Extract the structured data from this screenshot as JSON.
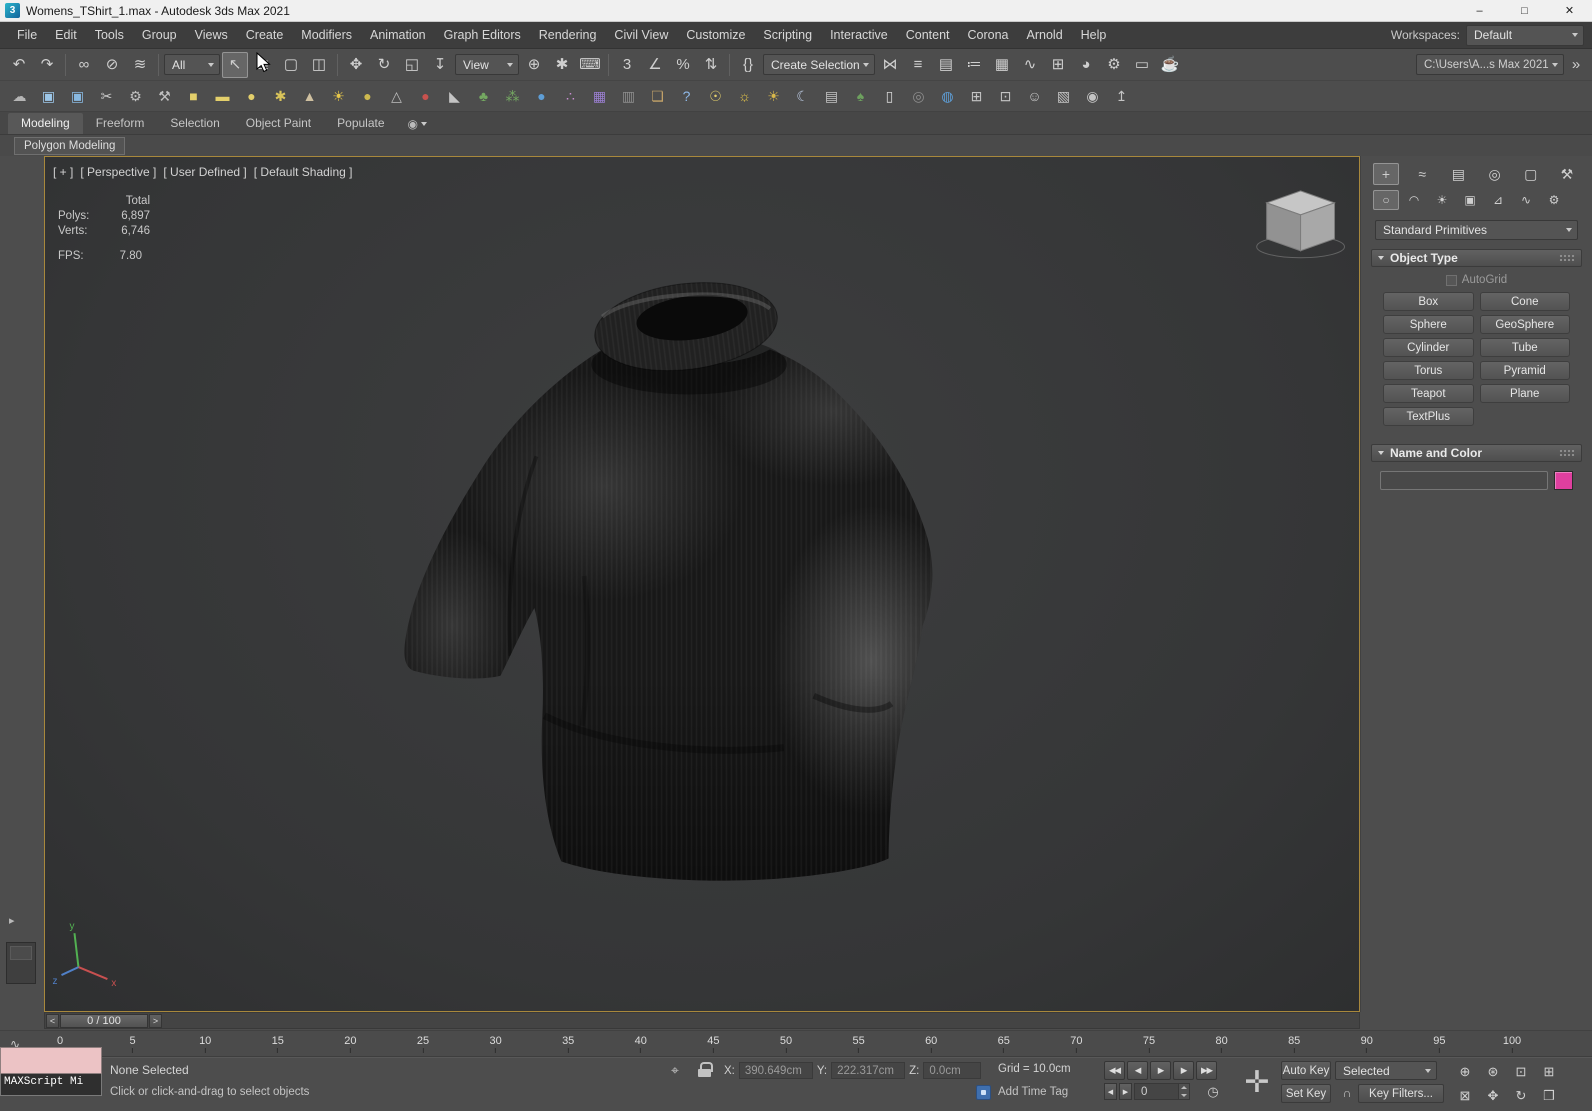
{
  "colors": {
    "chrome": "#4d4d4d",
    "titlebar": "#f0f0f0",
    "viewport-border": "#a8883c",
    "swatch": "#df3f9f",
    "maxscript-pink": "#ecc3c5"
  },
  "titlebar": {
    "icon_text": "3",
    "title": "Womens_TShirt_1.max - Autodesk 3ds Max 2021",
    "minimize": "–",
    "maximize": "□",
    "close": "✕"
  },
  "menubar": {
    "items": [
      {
        "label": "File",
        "name": "menu-file"
      },
      {
        "label": "Edit",
        "name": "menu-edit"
      },
      {
        "label": "Tools",
        "name": "menu-tools"
      },
      {
        "label": "Group",
        "name": "menu-group"
      },
      {
        "label": "Views",
        "name": "menu-views"
      },
      {
        "label": "Create",
        "name": "menu-create"
      },
      {
        "label": "Modifiers",
        "name": "menu-modifiers"
      },
      {
        "label": "Animation",
        "name": "menu-animation"
      },
      {
        "label": "Graph Editors",
        "name": "menu-graph-editors"
      },
      {
        "label": "Rendering",
        "name": "menu-rendering"
      },
      {
        "label": "Civil View",
        "name": "menu-civil-view"
      },
      {
        "label": "Customize",
        "name": "menu-customize"
      },
      {
        "label": "Scripting",
        "name": "menu-scripting"
      },
      {
        "label": "Interactive",
        "name": "menu-interactive"
      },
      {
        "label": "Content",
        "name": "menu-content"
      },
      {
        "label": "Corona",
        "name": "menu-corona"
      },
      {
        "label": "Arnold",
        "name": "menu-arnold"
      },
      {
        "label": "Help",
        "name": "menu-help"
      }
    ],
    "workspaces_label": "Workspaces:",
    "workspaces_value": "Default"
  },
  "toolbar1": {
    "history": [
      {
        "name": "undo-button",
        "glyph": "↶"
      },
      {
        "name": "redo-button",
        "glyph": "↷"
      }
    ],
    "link": [
      {
        "name": "select-and-link-button",
        "glyph": "∞"
      },
      {
        "name": "unlink-selection-button",
        "glyph": "⊘"
      },
      {
        "name": "bind-to-space-warp-button",
        "glyph": "≋"
      }
    ],
    "filter_value": "All",
    "select": [
      {
        "name": "select-object-button",
        "glyph": "↖",
        "active": true
      },
      {
        "name": "select-by-name-button",
        "glyph": "≣"
      },
      {
        "name": "rectangular-selection-button",
        "glyph": "▢"
      },
      {
        "name": "window-crossing-button",
        "glyph": "◫"
      }
    ],
    "transform": [
      {
        "name": "select-and-move-button",
        "glyph": "✥"
      },
      {
        "name": "select-and-rotate-button",
        "glyph": "↻"
      },
      {
        "name": "select-and-scale-button",
        "glyph": "◱"
      },
      {
        "name": "select-and-place-button",
        "glyph": "↧"
      }
    ],
    "coord_value": "View",
    "pivot": [
      {
        "name": "use-pivot-point-center-button",
        "glyph": "⊕"
      },
      {
        "name": "select-and-manipulate-button",
        "glyph": "✱"
      },
      {
        "name": "keyboard-override-button",
        "glyph": "⌨"
      }
    ],
    "snaps": [
      {
        "name": "snaps-toggle-button",
        "glyph": "3"
      },
      {
        "name": "angle-snap-button",
        "glyph": "∠"
      },
      {
        "name": "percent-snap-button",
        "glyph": "%"
      },
      {
        "name": "spinner-snap-button",
        "glyph": "⇅"
      }
    ],
    "named_sets_glyph": "{}",
    "sets_value": "Create Selection Se",
    "tools": [
      {
        "name": "mirror-button",
        "glyph": "⋈"
      },
      {
        "name": "align-button",
        "glyph": "≡"
      },
      {
        "name": "toggle-scene-explorer-button",
        "glyph": "▤"
      },
      {
        "name": "toggle-layer-explorer-button",
        "glyph": "≔"
      },
      {
        "name": "toggle-ribbon-button",
        "glyph": "▦"
      },
      {
        "name": "curve-editor-button",
        "glyph": "∿"
      },
      {
        "name": "schematic-view-button",
        "glyph": "⊞"
      },
      {
        "name": "material-editor-button",
        "glyph": "◕"
      },
      {
        "name": "render-setup-button",
        "glyph": "⚙"
      },
      {
        "name": "rendered-frame-button",
        "glyph": "▭"
      },
      {
        "name": "render-production-button",
        "glyph": "☕"
      }
    ],
    "project_path": "C:\\Users\\A...s Max 2021",
    "overflow_glyph": "»"
  },
  "toolbar2": {
    "items": [
      {
        "name": "paint-deform-icon",
        "glyph": "☁",
        "color": "#b5b5b5"
      },
      {
        "name": "snap-box-icon",
        "glyph": "▣",
        "color": "#9cc6e8"
      },
      {
        "name": "snap-box-alt-icon",
        "glyph": "▣",
        "color": "#88b8e0"
      },
      {
        "name": "cut-tool-icon",
        "glyph": "✂",
        "color": "#c8c8c8"
      },
      {
        "name": "gears-tool-icon",
        "glyph": "⚙",
        "color": "#c0c0c0"
      },
      {
        "name": "pick-tool-icon",
        "glyph": "⚒",
        "color": "#c0c0c0"
      },
      {
        "name": "box-primitive-icon",
        "glyph": "■",
        "color": "#e3cf6b"
      },
      {
        "name": "capsule-primitive-icon",
        "glyph": "▬",
        "color": "#e3cf6b"
      },
      {
        "name": "circle-primitive-icon",
        "glyph": "●",
        "color": "#e3cf6b"
      },
      {
        "name": "gear-primitive-icon",
        "glyph": "✱",
        "color": "#d8c35a"
      },
      {
        "name": "cone-primitive-icon",
        "glyph": "▲",
        "color": "#cfc0a0"
      },
      {
        "name": "sun-primitive-icon",
        "glyph": "☀",
        "color": "#e8c84a"
      },
      {
        "name": "sphere-primitive-icon",
        "glyph": "●",
        "color": "#cdb94f"
      },
      {
        "name": "lattice-icon",
        "glyph": "△",
        "color": "#bdbdbd"
      },
      {
        "name": "red-sphere-icon",
        "glyph": "●",
        "color": "#c8524e"
      },
      {
        "name": "pyramid-icon",
        "glyph": "◣",
        "color": "#c4c4c4"
      },
      {
        "name": "foliage-icon",
        "glyph": "♣",
        "color": "#74a861"
      },
      {
        "name": "grass-icon",
        "glyph": "⁂",
        "color": "#74a861"
      },
      {
        "name": "blue-sphere-icon",
        "glyph": "●",
        "color": "#5e9ed6"
      },
      {
        "name": "molecule-icon",
        "glyph": "∴",
        "color": "#c98fd2"
      },
      {
        "name": "image-map-icon",
        "glyph": "▦",
        "color": "#9a7fd0"
      },
      {
        "name": "portrait-icon",
        "glyph": "▥",
        "color": "#8d8d8d"
      },
      {
        "name": "crate-icon",
        "glyph": "❏",
        "color": "#c4a369"
      },
      {
        "name": "help-icon",
        "glyph": "?",
        "color": "#8fb9e8"
      },
      {
        "name": "lightbulb-icon",
        "glyph": "☉",
        "color": "#e3cf6b"
      },
      {
        "name": "sunlight-icon",
        "glyph": "☼",
        "color": "#e8c84a"
      },
      {
        "name": "daylight-icon",
        "glyph": "☀",
        "color": "#d8b84a"
      },
      {
        "name": "moon-icon",
        "glyph": "☾",
        "color": "#bac9e2"
      },
      {
        "name": "book-icon",
        "glyph": "▤",
        "color": "#c4c4c4"
      },
      {
        "name": "tree-icon",
        "glyph": "♠",
        "color": "#6da05e"
      },
      {
        "name": "page-icon",
        "glyph": "▯",
        "color": "#d6d6d6"
      },
      {
        "name": "torus-icon",
        "glyph": "◎",
        "color": "#8d8d8d"
      },
      {
        "name": "globe-icon",
        "glyph": "◍",
        "color": "#5e9ed6"
      },
      {
        "name": "grid-plus-icon",
        "glyph": "⊞",
        "color": "#c4c4c4"
      },
      {
        "name": "monitor-icon",
        "glyph": "⊡",
        "color": "#c4c4c4"
      },
      {
        "name": "people-icon",
        "glyph": "☺",
        "color": "#c4c4c4"
      },
      {
        "name": "film-icon",
        "glyph": "▧",
        "color": "#c4c4c4"
      },
      {
        "name": "eye-icon",
        "glyph": "◉",
        "color": "#c4c4c4"
      },
      {
        "name": "lamp-icon",
        "glyph": "↥",
        "color": "#c4c4c4"
      }
    ]
  },
  "ribbon": {
    "tabs": [
      {
        "label": "Modeling",
        "name": "ribbon-tab-modeling",
        "active": true
      },
      {
        "label": "Freeform",
        "name": "ribbon-tab-freeform"
      },
      {
        "label": "Selection",
        "name": "ribbon-tab-selection"
      },
      {
        "label": "Object Paint",
        "name": "ribbon-tab-object-paint"
      },
      {
        "label": "Populate",
        "name": "ribbon-tab-populate"
      }
    ],
    "overflow_glyph": "◉",
    "panel_tab": "Polygon Modeling"
  },
  "viewport": {
    "label_segments": [
      {
        "text": "[ + ]",
        "name": "viewport-general-menu"
      },
      {
        "text": "[ Perspective ]",
        "name": "viewport-pov-menu"
      },
      {
        "text": "[ User Defined ]",
        "name": "viewport-lighting-menu"
      },
      {
        "text": "[ Default Shading ]",
        "name": "viewport-shading-menu"
      }
    ],
    "stats": {
      "total_label": "Total",
      "polys_label": "Polys:",
      "polys_value": "6,897",
      "verts_label": "Verts:",
      "verts_value": "6,746",
      "fps_label": "FPS:",
      "fps_value": "7.80"
    }
  },
  "command_panel": {
    "tabs": [
      {
        "name": "tab-create",
        "glyph": "+",
        "active": true
      },
      {
        "name": "tab-modify",
        "glyph": "≈"
      },
      {
        "name": "tab-hierarchy",
        "glyph": "▤"
      },
      {
        "name": "tab-motion",
        "glyph": "◎"
      },
      {
        "name": "tab-display",
        "glyph": "▢"
      },
      {
        "name": "tab-utilities",
        "glyph": "⚒"
      }
    ],
    "subtabs": [
      {
        "name": "subtab-geometry",
        "glyph": "○",
        "active": true
      },
      {
        "name": "subtab-shapes",
        "glyph": "◠"
      },
      {
        "name": "subtab-lights",
        "glyph": "☀"
      },
      {
        "name": "subtab-cameras",
        "glyph": "▣"
      },
      {
        "name": "subtab-helpers",
        "glyph": "⊿"
      },
      {
        "name": "subtab-space-warps",
        "glyph": "∿"
      },
      {
        "name": "subtab-systems",
        "glyph": "⚙"
      }
    ],
    "category_dropdown": "Standard Primitives",
    "object_type": {
      "title": "Object Type",
      "autogrid_label": "AutoGrid",
      "buttons": [
        {
          "label": "Box",
          "name": "object-type-box-button"
        },
        {
          "label": "Cone",
          "name": "object-type-cone-button"
        },
        {
          "label": "Sphere",
          "name": "object-type-sphere-button"
        },
        {
          "label": "GeoSphere",
          "name": "object-type-geosphere-button"
        },
        {
          "label": "Cylinder",
          "name": "object-type-cylinder-button"
        },
        {
          "label": "Tube",
          "name": "object-type-tube-button"
        },
        {
          "label": "Torus",
          "name": "object-type-torus-button"
        },
        {
          "label": "Pyramid",
          "name": "object-type-pyramid-button"
        },
        {
          "label": "Teapot",
          "name": "object-type-teapot-button"
        },
        {
          "label": "Plane",
          "name": "object-type-plane-button"
        },
        {
          "label": "TextPlus",
          "name": "object-type-textplus-button"
        }
      ]
    },
    "name_color": {
      "title": "Name and Color"
    }
  },
  "timeline": {
    "prev": "<",
    "slider": "0 / 100",
    "next": ">",
    "ticks": [
      "0",
      "5",
      "10",
      "15",
      "20",
      "25",
      "30",
      "35",
      "40",
      "45",
      "50",
      "55",
      "60",
      "65",
      "70",
      "75",
      "80",
      "85",
      "90",
      "95",
      "100"
    ]
  },
  "statusbar": {
    "maxscript_listener_text": "MAXScript Mi",
    "selection_status": "None Selected",
    "prompt": "Click or click-and-drag to select objects",
    "coords": {
      "x_label": "X:",
      "x_value": "390.649cm",
      "y_label": "Y:",
      "y_value": "222.317cm",
      "z_label": "Z:",
      "z_value": "0.0cm"
    },
    "grid_text": "Grid = 10.0cm",
    "add_time_tag": "Add Time Tag",
    "transport": [
      {
        "name": "go-to-start-button",
        "glyph": "◀◀"
      },
      {
        "name": "previous-frame-button",
        "glyph": "◀"
      },
      {
        "name": "play-button",
        "glyph": "▶"
      },
      {
        "name": "next-frame-button",
        "glyph": "▶"
      },
      {
        "name": "go-to-end-button",
        "glyph": "▶▶"
      }
    ],
    "frame_nav": [
      {
        "name": "key-back-button",
        "glyph": "◀"
      },
      {
        "name": "key-forward-button",
        "glyph": "▶"
      }
    ],
    "frame_value": "0",
    "time_config_glyph": "◷",
    "set_keys_glyph": "✛",
    "auto_key_label": "Auto Key",
    "set_key_label": "Set Key",
    "selected_value": "Selected",
    "key_snap_glyph": "∩",
    "key_filters_label": "Key Filters...",
    "nav": [
      {
        "name": "zoom-button",
        "glyph": "⊕"
      },
      {
        "name": "zoom-all-button",
        "glyph": "⊛"
      },
      {
        "name": "zoom-extents-button",
        "glyph": "⊡"
      },
      {
        "name": "zoom-extents-all-button",
        "glyph": "⊞"
      },
      {
        "name": "zoom-region-button",
        "glyph": "⊠"
      },
      {
        "name": "pan-button",
        "glyph": "✥"
      },
      {
        "name": "orbit-button",
        "glyph": "↻"
      },
      {
        "name": "maximize-viewport-button",
        "glyph": "❒"
      }
    ]
  }
}
